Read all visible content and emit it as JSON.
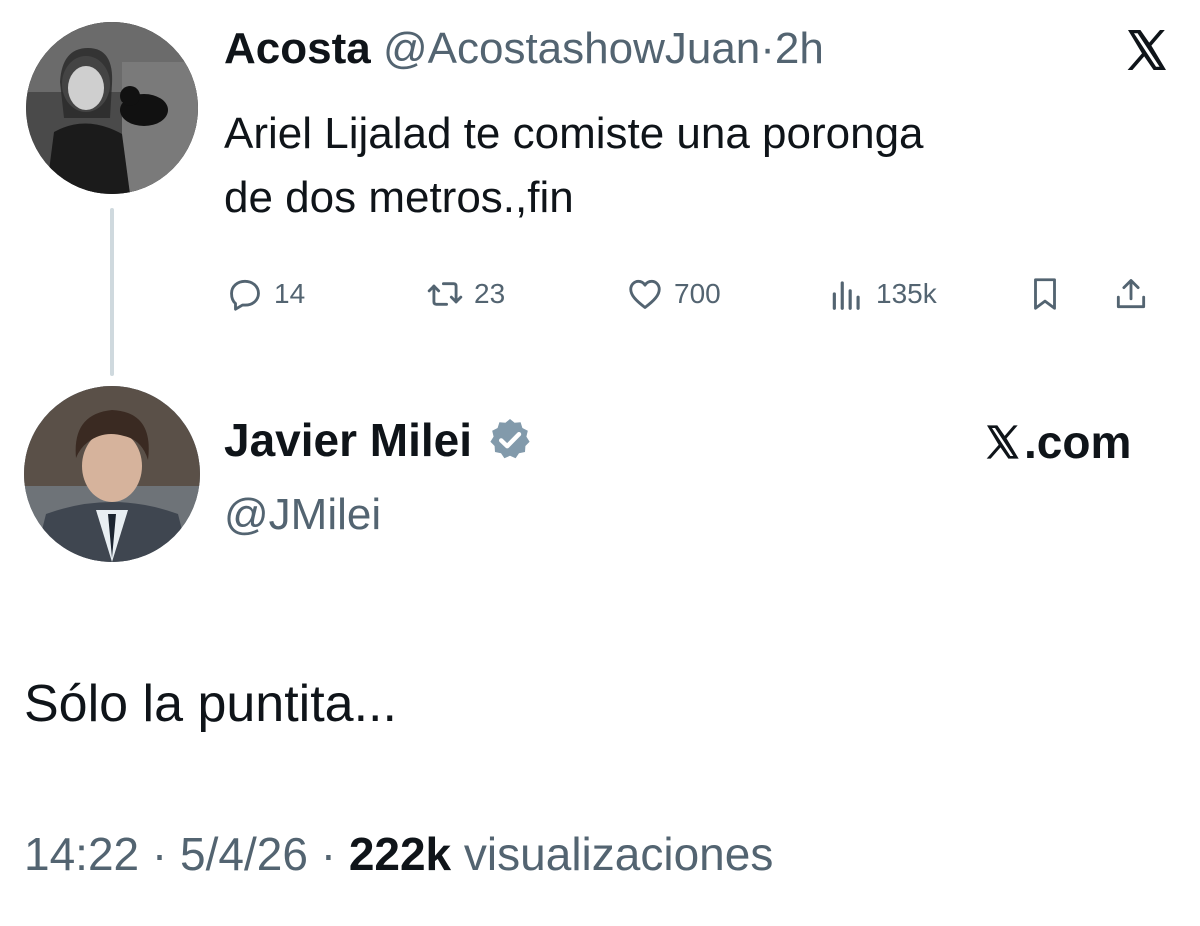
{
  "original_tweet": {
    "author_name": "Acosta",
    "author_handle": "@AcostashowJuan",
    "separator": "·",
    "time_ago": "2h",
    "text_line1": "Ariel Lijalad te comiste una poronga",
    "text_line2": "de dos metros.,fin",
    "avatar_icon": "profile-photo-grayscale",
    "brand_icon": "x-logo-icon",
    "actions": {
      "replies": "14",
      "reposts": "23",
      "likes": "700",
      "views": "135k"
    }
  },
  "reply_tweet": {
    "author_name": "Javier Milei",
    "author_handle": "@JMilei",
    "verified": true,
    "brand_label": ".com",
    "text": "Sólo la puntita...",
    "meta": {
      "time": "14:22",
      "separator": " · ",
      "date": "5/4/26",
      "views_count": "222k",
      "views_label": " visualizaciones"
    }
  },
  "colors": {
    "text_primary": "#0f1419",
    "text_secondary": "#536471",
    "verified_badge": "#829aab",
    "thread_line": "#cfd9de",
    "background": "#ffffff"
  }
}
